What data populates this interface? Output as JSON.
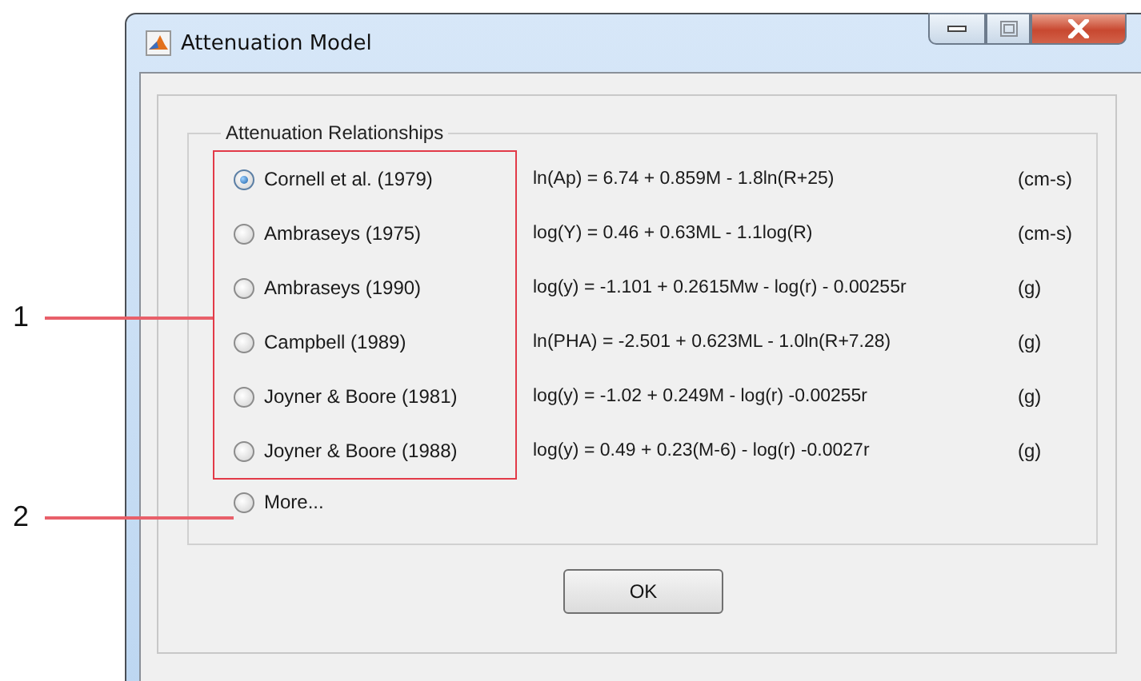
{
  "window": {
    "title": "Attenuation Model"
  },
  "group": {
    "title": "Attenuation Relationships"
  },
  "options": [
    {
      "kind": "relationship",
      "label": "Cornell et al. (1979)",
      "equation": "ln(Ap) = 6.74 + 0.859M - 1.8ln(R+25)",
      "units": "(cm-s)",
      "selected": true
    },
    {
      "kind": "relationship",
      "label": "Ambraseys (1975)",
      "equation": "log(Y) = 0.46 + 0.63ML - 1.1log(R)",
      "units": "(cm-s)",
      "selected": false
    },
    {
      "kind": "relationship",
      "label": "Ambraseys (1990)",
      "equation": "log(y) = -1.101 + 0.2615Mw - log(r) - 0.00255r",
      "units": "(g)",
      "selected": false
    },
    {
      "kind": "relationship",
      "label": "Campbell (1989)",
      "equation": "ln(PHA) = -2.501 + 0.623ML - 1.0ln(R+7.28)",
      "units": "(g)",
      "selected": false
    },
    {
      "kind": "relationship",
      "label": "Joyner & Boore (1981)",
      "equation": "log(y) = -1.02 + 0.249M - log(r) -0.00255r",
      "units": "(g)",
      "selected": false
    },
    {
      "kind": "relationship",
      "label": "Joyner & Boore (1988)",
      "equation": "log(y) = 0.49 + 0.23(M-6) - log(r) -0.0027r",
      "units": "(g)",
      "selected": false
    },
    {
      "kind": "more",
      "label": "More...",
      "selected": false
    }
  ],
  "callouts": [
    {
      "label": "1"
    },
    {
      "label": "2"
    }
  ],
  "ok_button": {
    "label": "OK"
  }
}
